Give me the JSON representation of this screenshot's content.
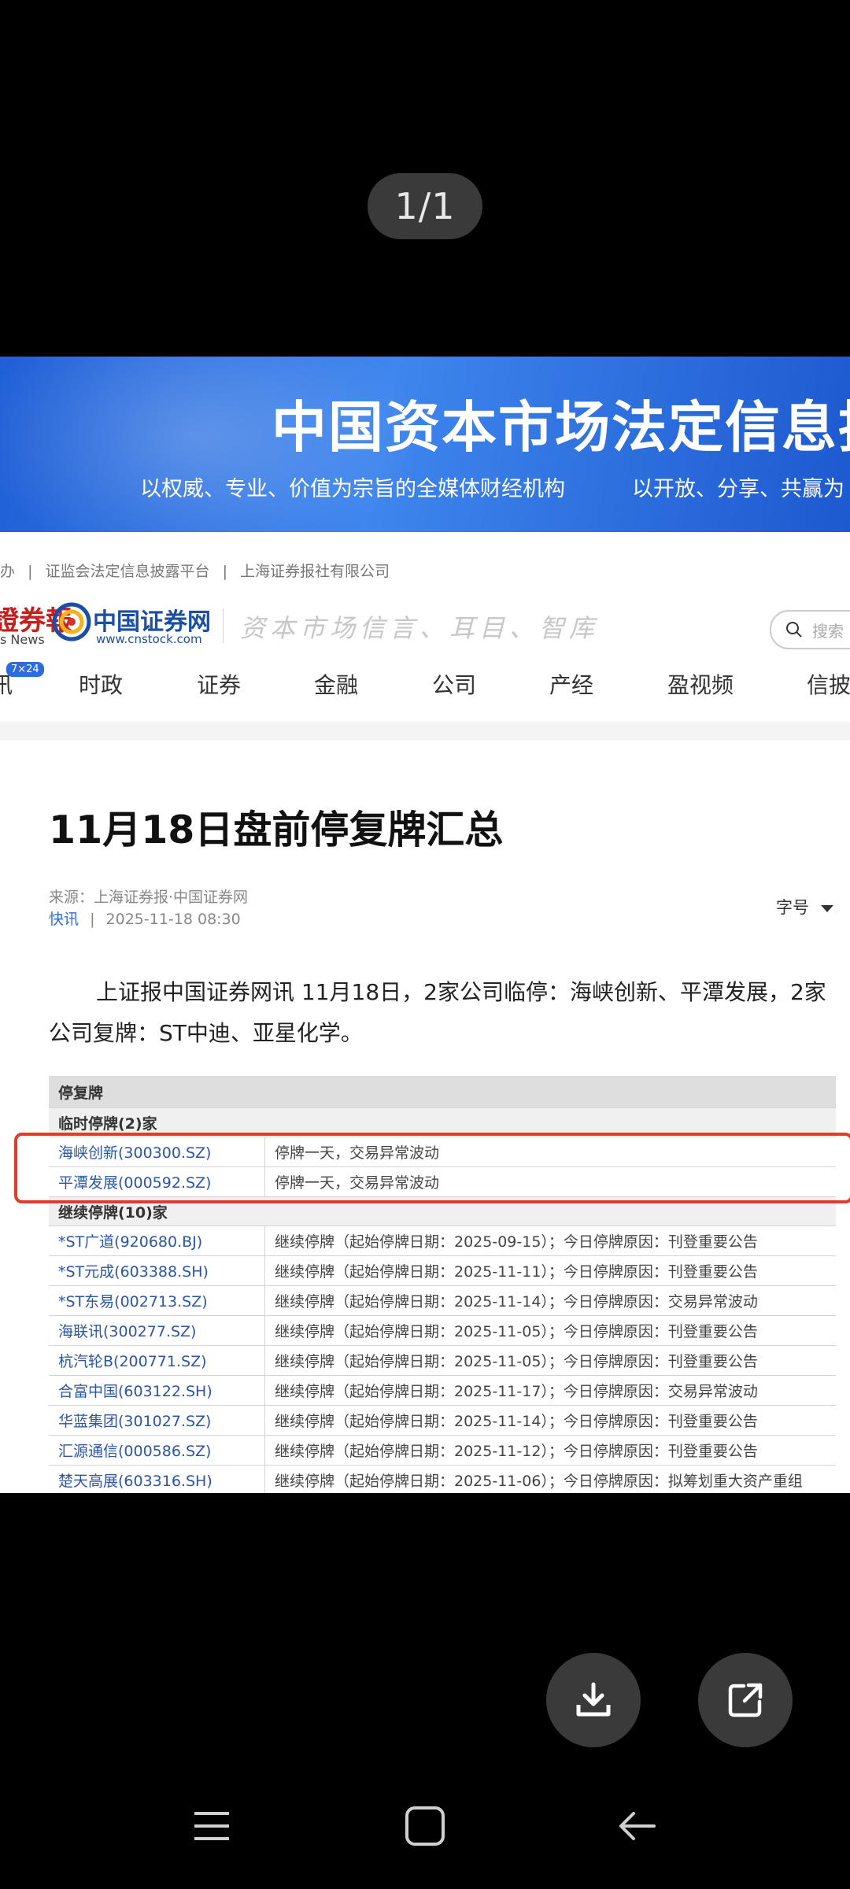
{
  "viewer": {
    "counter": "1/1"
  },
  "banner": {
    "title": "中国资本市场法定信息披",
    "subtitle_left": "以权威、专业、价值为宗旨的全媒体财经机构",
    "subtitle_right": "以开放、分享、共赢为"
  },
  "top_links": [
    "办",
    "|",
    "证监会法定信息披露平台",
    "|",
    "上海证券报社有限公司"
  ],
  "logos": {
    "newspaper_mark": "證券報",
    "newspaper_sub": "s News",
    "site_name": "中国证券网",
    "site_url": "www.cnstock.com",
    "slogan": "资本市场信言、耳目、智库"
  },
  "search": {
    "placeholder": "搜索"
  },
  "nav": {
    "badge": "7×24",
    "items": [
      "讯",
      "时政",
      "证券",
      "金融",
      "公司",
      "产经",
      "盈视频",
      "信披"
    ]
  },
  "article": {
    "title": "11月18日盘前停复牌汇总",
    "source": "来源：上海证券报·中国证券网",
    "tag": "快讯",
    "separator": "|",
    "datetime": "2025-11-18 08:30",
    "font_size_label": "字号",
    "body": "上证报中国证券网讯 11月18日，2家公司临停：海峡创新、平潭发展，2家公司复牌：ST中迪、亚星化学。"
  },
  "table": {
    "header": "停复牌",
    "temp_section": "临时停牌(2)家",
    "temp_rows": [
      {
        "stock": "海峡创新(300300.SZ)",
        "detail": "停牌一天，交易异常波动"
      },
      {
        "stock": "平潭发展(000592.SZ)",
        "detail": "停牌一天，交易异常波动"
      }
    ],
    "cont_section": "继续停牌(10)家",
    "cont_rows": [
      {
        "stock": "*ST广道(920680.BJ)",
        "detail": "继续停牌（起始停牌日期：2025-09-15）；今日停牌原因：刊登重要公告"
      },
      {
        "stock": "*ST元成(603388.SH)",
        "detail": "继续停牌（起始停牌日期：2025-11-11）；今日停牌原因：刊登重要公告"
      },
      {
        "stock": "*ST东易(002713.SZ)",
        "detail": "继续停牌（起始停牌日期：2025-11-14）；今日停牌原因：交易异常波动"
      },
      {
        "stock": "海联讯(300277.SZ)",
        "detail": "继续停牌（起始停牌日期：2025-11-05）；今日停牌原因：刊登重要公告"
      },
      {
        "stock": "杭汽轮B(200771.SZ)",
        "detail": "继续停牌（起始停牌日期：2025-11-05）；今日停牌原因：刊登重要公告"
      },
      {
        "stock": "合富中国(603122.SH)",
        "detail": "继续停牌（起始停牌日期：2025-11-17）；今日停牌原因：交易异常波动"
      },
      {
        "stock": "华蓝集团(301027.SZ)",
        "detail": "继续停牌（起始停牌日期：2025-11-14）；今日停牌原因：刊登重要公告"
      },
      {
        "stock": "汇源通信(000586.SZ)",
        "detail": "继续停牌（起始停牌日期：2025-11-12）；今日停牌原因：刊登重要公告"
      },
      {
        "stock": "楚天高展(603316.SH)",
        "detail": "继续停牌（起始停牌日期：2025-11-06）；今日停牌原因：拟筹划重大资产重组"
      }
    ]
  },
  "actions": {
    "download_icon": "download-icon",
    "share_icon": "share-icon"
  },
  "system_nav": [
    "menu-icon",
    "home-icon",
    "back-icon"
  ],
  "colors": {
    "highlight_box": "#e23b2c",
    "link": "#2b55a6",
    "banner": "#2f74e6"
  }
}
